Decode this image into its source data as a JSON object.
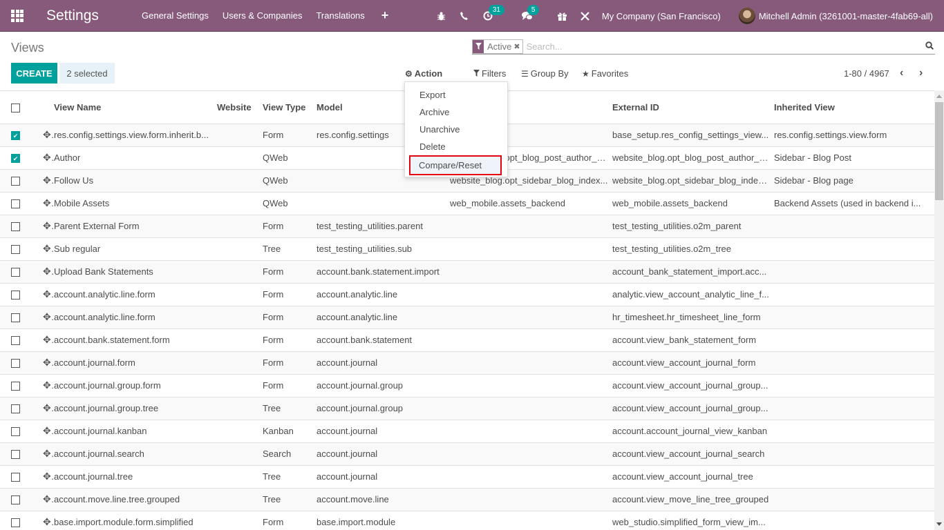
{
  "navbar": {
    "brand": "Settings",
    "menu": [
      "General Settings",
      "Users & Companies",
      "Translations"
    ],
    "plus_icon": "+",
    "systray": {
      "debug_icon": "bug-icon",
      "phone_icon": "phone-icon",
      "activity_badge": "31",
      "messages_badge": "5",
      "gift_icon": "gift-icon",
      "tools_icon": "tools-icon"
    },
    "company": "My Company (San Francisco)",
    "user": "Mitchell Admin (3261001-master-4fab69-all)"
  },
  "control_panel": {
    "breadcrumb": "Views",
    "create_label": "CREATE",
    "selected_label": "2 selected",
    "search": {
      "facet_value": "Active",
      "placeholder": "Search..."
    },
    "action_label": "Action",
    "filters_label": "Filters",
    "groupby_label": "Group By",
    "favorites_label": "Favorites",
    "pager": "1-80 / 4967"
  },
  "action_menu": {
    "items": [
      "Export",
      "Archive",
      "Unarchive",
      "Delete",
      "Compare/Reset"
    ],
    "highlighted": "Compare/Reset"
  },
  "table": {
    "columns": [
      "View Name",
      "Website",
      "View Type",
      "Model",
      "",
      "External ID",
      "Inherited View"
    ],
    "rows": [
      {
        "checked": true,
        "name": "res.config.settings.view.form.inherit.b...",
        "website": "",
        "type": "Form",
        "model": "res.config.settings",
        "hidden": "",
        "external_id": "base_setup.res_config_settings_view...",
        "inherited": "res.config.settings.view.form"
      },
      {
        "checked": true,
        "name": "Author",
        "website": "",
        "type": "QWeb",
        "model": "",
        "hidden": "website_blog.opt_blog_post_author_a...",
        "external_id": "website_blog.opt_blog_post_author_a...",
        "inherited": "Sidebar - Blog Post"
      },
      {
        "checked": false,
        "name": "Follow Us",
        "website": "",
        "type": "QWeb",
        "model": "",
        "hidden": "website_blog.opt_sidebar_blog_index...",
        "external_id": "website_blog.opt_sidebar_blog_index...",
        "inherited": "Sidebar - Blog page"
      },
      {
        "checked": false,
        "name": "Mobile Assets",
        "website": "",
        "type": "QWeb",
        "model": "",
        "hidden": "web_mobile.assets_backend",
        "external_id": "web_mobile.assets_backend",
        "inherited": "Backend Assets (used in backend i..."
      },
      {
        "checked": false,
        "name": "Parent External Form",
        "website": "",
        "type": "Form",
        "model": "test_testing_utilities.parent",
        "hidden": "",
        "external_id": "test_testing_utilities.o2m_parent",
        "inherited": ""
      },
      {
        "checked": false,
        "name": "Sub regular",
        "website": "",
        "type": "Tree",
        "model": "test_testing_utilities.sub",
        "hidden": "",
        "external_id": "test_testing_utilities.o2m_tree",
        "inherited": ""
      },
      {
        "checked": false,
        "name": "Upload Bank Statements",
        "website": "",
        "type": "Form",
        "model": "account.bank.statement.import",
        "hidden": "",
        "external_id": "account_bank_statement_import.acc...",
        "inherited": ""
      },
      {
        "checked": false,
        "name": "account.analytic.line.form",
        "website": "",
        "type": "Form",
        "model": "account.analytic.line",
        "hidden": "",
        "external_id": "analytic.view_account_analytic_line_f...",
        "inherited": ""
      },
      {
        "checked": false,
        "name": "account.analytic.line.form",
        "website": "",
        "type": "Form",
        "model": "account.analytic.line",
        "hidden": "",
        "external_id": "hr_timesheet.hr_timesheet_line_form",
        "inherited": ""
      },
      {
        "checked": false,
        "name": "account.bank.statement.form",
        "website": "",
        "type": "Form",
        "model": "account.bank.statement",
        "hidden": "",
        "external_id": "account.view_bank_statement_form",
        "inherited": ""
      },
      {
        "checked": false,
        "name": "account.journal.form",
        "website": "",
        "type": "Form",
        "model": "account.journal",
        "hidden": "",
        "external_id": "account.view_account_journal_form",
        "inherited": ""
      },
      {
        "checked": false,
        "name": "account.journal.group.form",
        "website": "",
        "type": "Form",
        "model": "account.journal.group",
        "hidden": "",
        "external_id": "account.view_account_journal_group...",
        "inherited": ""
      },
      {
        "checked": false,
        "name": "account.journal.group.tree",
        "website": "",
        "type": "Tree",
        "model": "account.journal.group",
        "hidden": "",
        "external_id": "account.view_account_journal_group...",
        "inherited": ""
      },
      {
        "checked": false,
        "name": "account.journal.kanban",
        "website": "",
        "type": "Kanban",
        "model": "account.journal",
        "hidden": "",
        "external_id": "account.account_journal_view_kanban",
        "inherited": ""
      },
      {
        "checked": false,
        "name": "account.journal.search",
        "website": "",
        "type": "Search",
        "model": "account.journal",
        "hidden": "",
        "external_id": "account.view_account_journal_search",
        "inherited": ""
      },
      {
        "checked": false,
        "name": "account.journal.tree",
        "website": "",
        "type": "Tree",
        "model": "account.journal",
        "hidden": "",
        "external_id": "account.view_account_journal_tree",
        "inherited": ""
      },
      {
        "checked": false,
        "name": "account.move.line.tree.grouped",
        "website": "",
        "type": "Tree",
        "model": "account.move.line",
        "hidden": "",
        "external_id": "account.view_move_line_tree_grouped",
        "inherited": ""
      },
      {
        "checked": false,
        "name": "base.import.module.form.simplified",
        "website": "",
        "type": "Form",
        "model": "base.import.module",
        "hidden": "",
        "external_id": "web_studio.simplified_form_view_im...",
        "inherited": ""
      }
    ]
  },
  "colors": {
    "brand": "#875a7b",
    "primary": "#00a09d",
    "highlight_border": "#e3000f"
  }
}
